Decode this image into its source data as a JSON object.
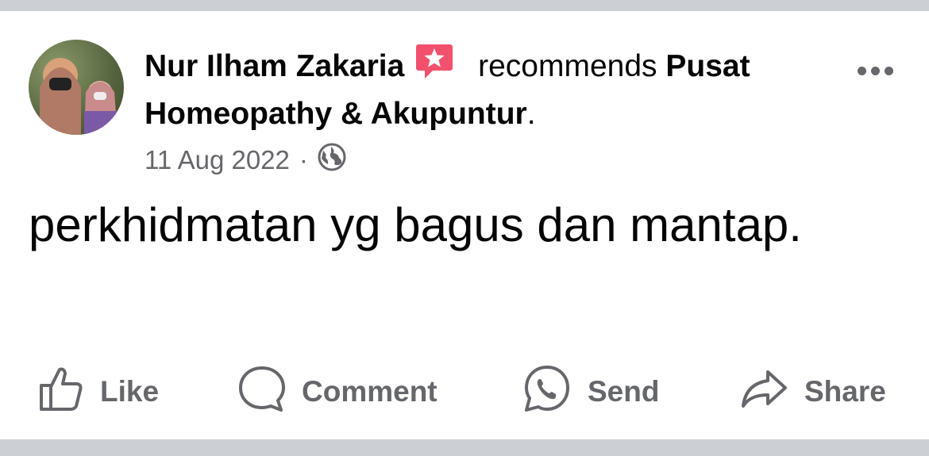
{
  "post": {
    "author": "Nur Ilham Zakaria",
    "verb": " recommends ",
    "page": "Pusat Homeopathy & Akupuntur",
    "period": ".",
    "date": "11 Aug 2022",
    "separator": "·",
    "text": "perkhidmatan yg bagus dan mantap."
  },
  "actions": {
    "like": "Like",
    "comment": "Comment",
    "send": "Send",
    "share": "Share"
  },
  "colors": {
    "secondary_text": "#65676b",
    "badge": "#f2516e",
    "background": "#ccd0d5"
  },
  "icons": [
    "recommend-badge-icon",
    "globe-icon",
    "more-icon",
    "like-icon",
    "comment-icon",
    "send-icon",
    "share-icon"
  ]
}
